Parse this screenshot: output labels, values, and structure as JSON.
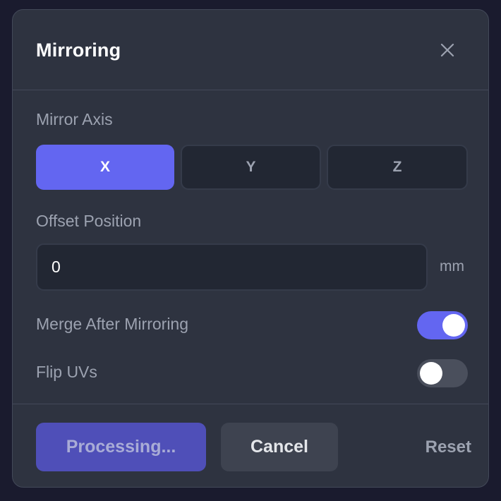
{
  "dialog": {
    "title": "Mirroring"
  },
  "mirror_axis": {
    "label": "Mirror Axis",
    "options": [
      "X",
      "Y",
      "Z"
    ],
    "selected": "X"
  },
  "offset": {
    "label": "Offset Position",
    "value": "0",
    "unit": "mm"
  },
  "toggles": {
    "merge": {
      "label": "Merge After Mirroring",
      "on": true
    },
    "flip_uvs": {
      "label": "Flip UVs",
      "on": false
    }
  },
  "footer": {
    "primary_label": "Processing...",
    "cancel_label": "Cancel",
    "reset_label": "Reset"
  },
  "colors": {
    "accent": "#6366f1",
    "background": "#2e3340"
  },
  "icons": {
    "close": "close-icon"
  }
}
